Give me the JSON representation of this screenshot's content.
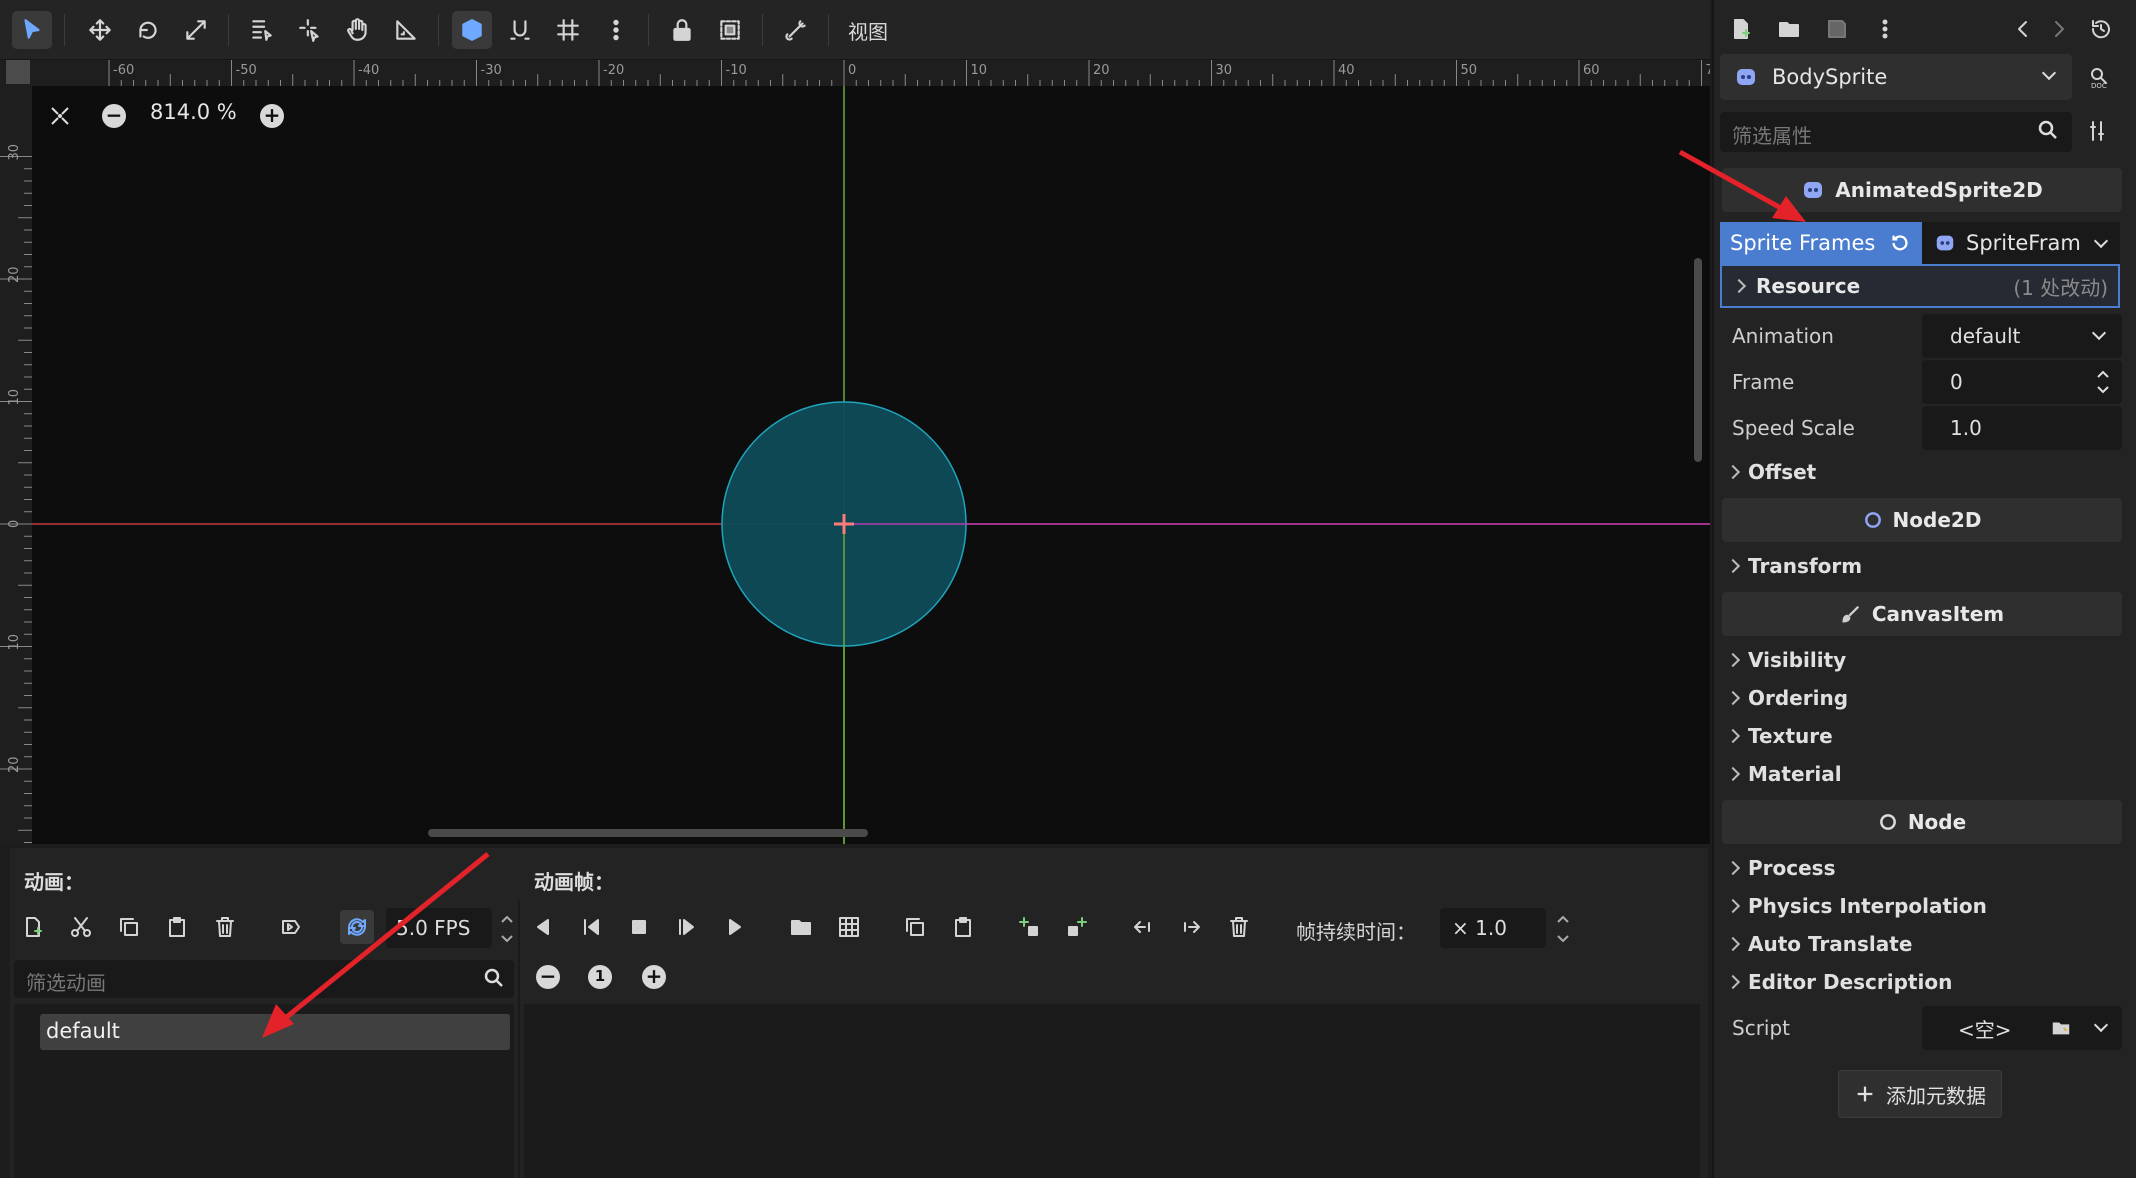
{
  "toolbar": {
    "view_label": "视图"
  },
  "canvas": {
    "zoom": "814.0 %",
    "ruler_h": [
      "-60",
      "-50",
      "-40",
      "-30",
      "-20",
      "-10",
      "0",
      "10",
      "20",
      "30",
      "40",
      "50",
      "60",
      "7"
    ],
    "ruler_v": [
      "30",
      "20",
      "10",
      "0",
      "10",
      "20"
    ]
  },
  "bottom": {
    "animations_label": "动画：",
    "frames_label": "动画帧：",
    "fps": "5.0 FPS",
    "filter_placeholder": "筛选动画",
    "duration_label": "帧持续时间：",
    "duration_value": "× 1.0",
    "animations": [
      "default"
    ]
  },
  "inspector": {
    "node_name": "BodySprite",
    "filter_placeholder": "筛选属性",
    "class_animated": "AnimatedSprite2D",
    "sprite_frames_label": "Sprite Frames",
    "sprite_frames_value": "SpriteFram",
    "resource_label": "Resource",
    "resource_changes": "(1 处改动)",
    "animation_label": "Animation",
    "animation_value": "default",
    "frame_label": "Frame",
    "frame_value": "0",
    "speed_label": "Speed Scale",
    "speed_value": "1.0",
    "offset": "Offset",
    "class_node2d": "Node2D",
    "transform": "Transform",
    "class_canvasitem": "CanvasItem",
    "canvas_groups": [
      "Visibility",
      "Ordering",
      "Texture",
      "Material"
    ],
    "class_node": "Node",
    "node_groups": [
      "Process",
      "Physics Interpolation",
      "Auto Translate",
      "Editor Description"
    ],
    "script_label": "Script",
    "script_value": "<空>",
    "add_meta": "添加元数据"
  },
  "colors": {
    "accent": "#4a7ccf",
    "circle_fill": "#0e4c59",
    "circle_stroke": "#1fa5bd",
    "arrow": "#e3222a"
  }
}
